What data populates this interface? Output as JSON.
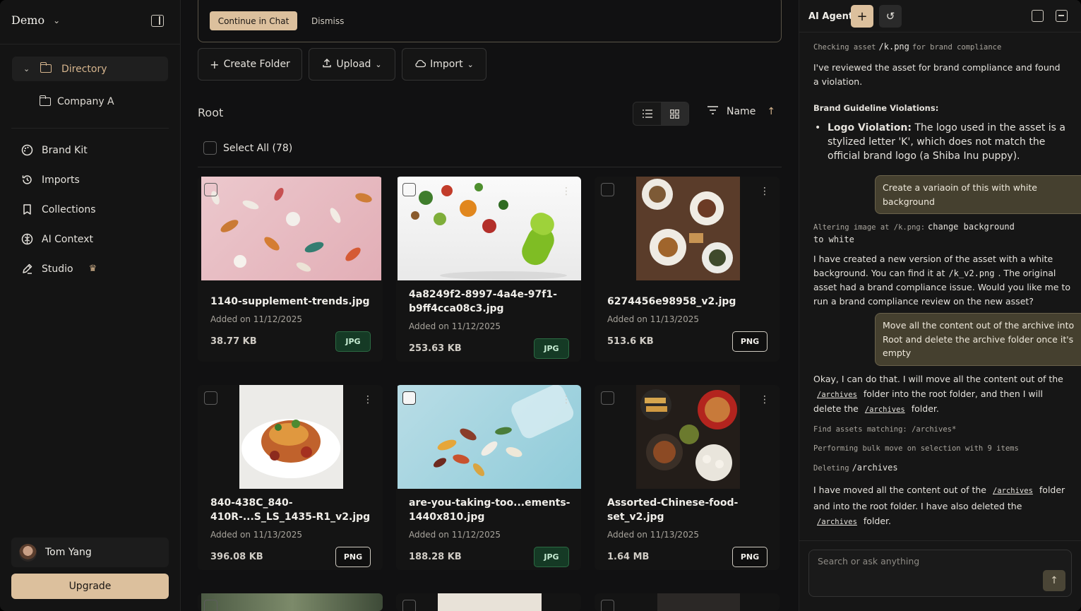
{
  "sidebar": {
    "workspace": "Demo",
    "directory_label": "Directory",
    "subfolder": "Company A",
    "nav": [
      {
        "label": "Brand Kit",
        "icon": "palette-icon"
      },
      {
        "label": "Imports",
        "icon": "history-icon"
      },
      {
        "label": "Collections",
        "icon": "bookmark-icon"
      },
      {
        "label": "AI Context",
        "icon": "brain-icon"
      },
      {
        "label": "Studio",
        "icon": "pen-icon"
      }
    ],
    "user_name": "Tom Yang",
    "upgrade_label": "Upgrade"
  },
  "notice": {
    "continue_label": "Continue in Chat",
    "dismiss_label": "Dismiss"
  },
  "toolbar": {
    "create_folder": "Create Folder",
    "upload": "Upload",
    "import": "Import"
  },
  "browser": {
    "location": "Root",
    "sort_label": "Name",
    "select_all": "Select All (78)"
  },
  "files": [
    {
      "name": "1140-supplement-trends.jpg",
      "added": "Added on 11/12/2025",
      "size": "38.77 KB",
      "type": "JPG"
    },
    {
      "name": "4a8249f2-8997-4a4e-97f1-b9ff4cca08c3.jpg",
      "added": "Added on 11/12/2025",
      "size": "253.63 KB",
      "type": "JPG"
    },
    {
      "name": "6274456e98958_v2.jpg",
      "added": "Added on 11/13/2025",
      "size": "513.6 KB",
      "type": "PNG"
    },
    {
      "name": "840-438C_840-410R-...S_LS_1435-R1_v2.jpg",
      "added": "Added on 11/13/2025",
      "size": "396.08 KB",
      "type": "PNG"
    },
    {
      "name": "are-you-taking-too...ements-1440x810.jpg",
      "added": "Added on 11/12/2025",
      "size": "188.28 KB",
      "type": "JPG"
    },
    {
      "name": "Assorted-Chinese-food-set_v2.jpg",
      "added": "Added on 11/13/2025",
      "size": "1.64 MB",
      "type": "PNG"
    }
  ],
  "agent": {
    "title": "AI Agent",
    "log1_pre": "Checking asset",
    "log1_code": "/k.png",
    "log1_post": "for brand compliance",
    "msg1": "I've reviewed the asset for brand compliance and found a violation.",
    "violations_heading": "Brand Guideline Violations:",
    "violation_label": "Logo Violation:",
    "violation_text": "The logo used in the asset is a stylized letter 'K', which does not match the official brand logo (a Shiba Inu puppy).",
    "user1": "Create a variaoin of this with white background",
    "log2_pre": "Altering image at /k.png:",
    "log2_code": "change background to white",
    "msg2_a": "I have created a new version of the asset with a white background. You can find it at",
    "msg2_code": "/k_v2.png",
    "msg2_b": ". The original asset had a brand compliance issue. Would you like me to run a brand compliance review on the new asset?",
    "user2": "Move all the content out of the archive into Root and delete the archive folder once it's empty",
    "msg3_a": "Okay, I can do that. I will move all the content out of the",
    "msg3_link1": "/archives",
    "msg3_b": "folder into the root folder, and then I will delete the",
    "msg3_link2": "/archives",
    "msg3_c": "folder.",
    "log3": "Find assets matching: /archives*",
    "log4": "Performing bulk move on selection with 9 items",
    "log5_pre": "Deleting",
    "log5_code": "/archives",
    "msg4_a": "I have moved all the content out of the",
    "msg4_link1": "/archives",
    "msg4_b": "folder and into the root folder. I have also deleted the",
    "msg4_link2": "/archives",
    "msg4_c": "folder.",
    "input_placeholder": "Search or ask anything"
  },
  "colors": {
    "accent": "#dcc09d",
    "directory_text": "#d5b48d",
    "jpg_badge": "#153a25",
    "user_bubble": "#45402f"
  }
}
